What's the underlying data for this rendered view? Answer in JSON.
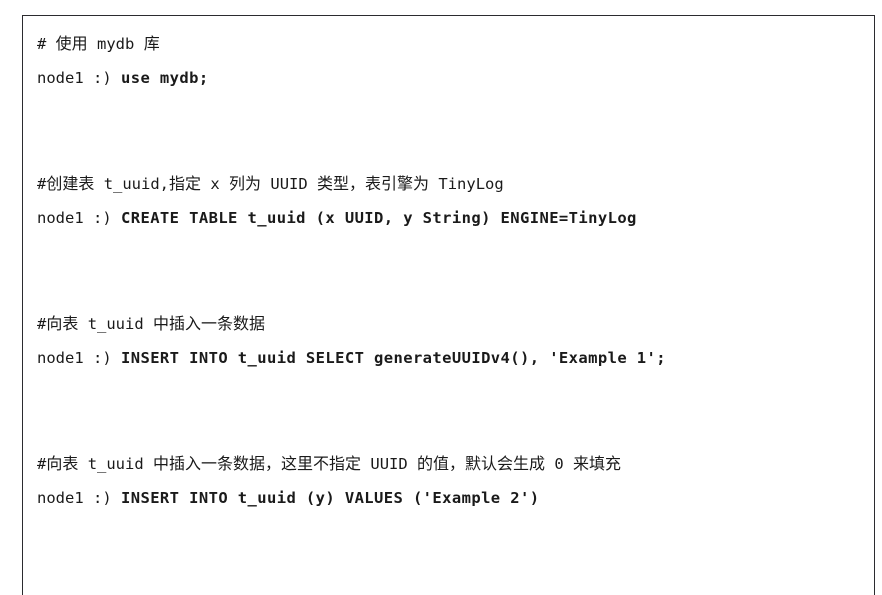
{
  "window": {
    "kind": "terminal-code-block",
    "background": "#ffffff",
    "border_color": "#2b2b2f",
    "text_color": "#1a1a1a"
  },
  "code_block": {
    "lines": [
      {
        "type": "comment",
        "name": "comment-use-database",
        "text": "# 使用 mydb 库"
      },
      {
        "type": "command",
        "name": "command-use-mydb",
        "prompt": "node1 :) ",
        "sql": "use mydb;"
      },
      {
        "type": "blank",
        "name": "blank-line-1",
        "text": " "
      },
      {
        "type": "blank",
        "name": "blank-line-2",
        "text": " "
      },
      {
        "type": "comment",
        "name": "comment-create-table",
        "text": "#创建表 t_uuid,指定 x 列为 UUID 类型，表引擎为 TinyLog"
      },
      {
        "type": "command",
        "name": "command-create-table",
        "prompt": "node1 :) ",
        "sql": "CREATE TABLE t_uuid (x UUID, y String) ENGINE=TinyLog"
      },
      {
        "type": "blank",
        "name": "blank-line-3",
        "text": " "
      },
      {
        "type": "blank",
        "name": "blank-line-4",
        "text": " "
      },
      {
        "type": "comment",
        "name": "comment-insert-row-1",
        "text": "#向表 t_uuid 中插入一条数据"
      },
      {
        "type": "command",
        "name": "command-insert-select",
        "prompt": "node1 :) ",
        "sql": "INSERT INTO t_uuid SELECT generateUUIDv4(), 'Example 1';"
      },
      {
        "type": "blank",
        "name": "blank-line-5",
        "text": " "
      },
      {
        "type": "blank",
        "name": "blank-line-6",
        "text": " "
      },
      {
        "type": "comment",
        "name": "comment-insert-row-2",
        "text": "#向表 t_uuid 中插入一条数据，这里不指定 UUID 的值，默认会生成 0 来填充"
      },
      {
        "type": "command",
        "name": "command-insert-values",
        "prompt": "node1 :) ",
        "sql": "INSERT INTO t_uuid (y) VALUES ('Example 2')"
      },
      {
        "type": "blank",
        "name": "blank-line-7",
        "text": " "
      }
    ]
  }
}
